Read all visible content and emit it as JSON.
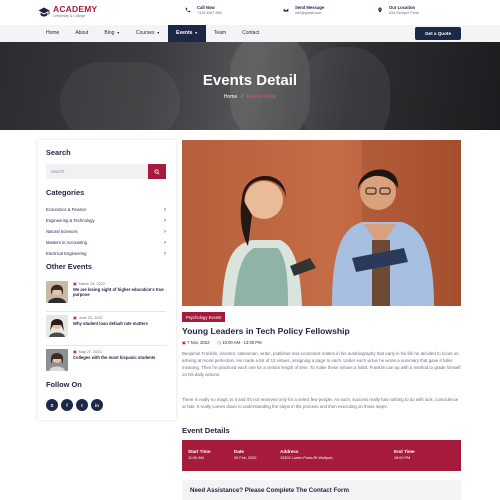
{
  "brand": {
    "name": "ACADEMY",
    "tagline": "University & College"
  },
  "contacts": [
    {
      "icon": "phone-icon",
      "label": "Call Now",
      "value": "+325 4567 890"
    },
    {
      "icon": "mail-icon",
      "label": "Send Message",
      "value": "info@gmail.com"
    },
    {
      "icon": "location-icon",
      "label": "Our Location",
      "value": "634 Semper Porta"
    }
  ],
  "nav": {
    "items": [
      "Home",
      "About",
      "Blog",
      "Courses",
      "Events",
      "Team",
      "Contact"
    ],
    "active": "Events",
    "cta": "Get a Quote"
  },
  "hero": {
    "title": "Events Detail",
    "crumb_home": "Home",
    "crumb_sep": "/",
    "crumb_current": "Events Detail"
  },
  "sidebar": {
    "search_heading": "Search",
    "search_placeholder": "Search",
    "categories_heading": "Categories",
    "categories": [
      "Economics & Finance",
      "Engineering & Technology",
      "Natural Sciences",
      "Masters in Accounting",
      "Electrical Engineering"
    ],
    "other_events_heading": "Other Events",
    "other_events": [
      {
        "date": "March 23, 2022",
        "title": "We are losing sight of higher education's true purpose"
      },
      {
        "date": "June 25, 2022",
        "title": "Why student loan default rate matters"
      },
      {
        "date": "May 27, 2022",
        "title": "Colleges with the most hispanic students"
      }
    ],
    "follow_heading": "Follow On",
    "social": [
      "skype-icon",
      "facebook-icon",
      "twitter-icon",
      "linkedin-icon"
    ]
  },
  "event": {
    "tag": "Psychology Events",
    "title": "Young Leaders in Tech Policy Fellowship",
    "date": "7 Nov, 2022",
    "time": "10:00 AM - 13:00 PM",
    "para1": "Benjamin Franklin, inventor, statesman, writer, publisher and economist relates in his autobiography that early in his life he decided to focus on arriving at moral perfection. He made a list of 13 virtues, assigning a page to each. Under each virtue he wrote a summary that gave it fuller meaning. Then he practiced each one for a certain length of time. To make these virtues a habit, Franklin can up with a method to grade himself on his daily actions.",
    "para2": "There is really no magic to it and it's not reserved only for a select few people. As such, success really has nothing to do with luck, coincidence or fate. It really comes down to understanding the steps in the process and then executing on those steps."
  },
  "details": {
    "heading": "Event Details",
    "columns": [
      {
        "key": "Start Time",
        "value": "11:00 AM"
      },
      {
        "key": "Date",
        "value": "30 Feb, 2020"
      },
      {
        "key": "Address",
        "value": "19302 Lorem Porta Rt Wolfport,"
      },
      {
        "key": "End Time",
        "value": "15:00 PM"
      }
    ]
  },
  "assist": {
    "title": "Need Assistance? Please Complete The Contact Form"
  },
  "colors": {
    "primary": "#a61b3b",
    "navy": "#1b2847"
  }
}
